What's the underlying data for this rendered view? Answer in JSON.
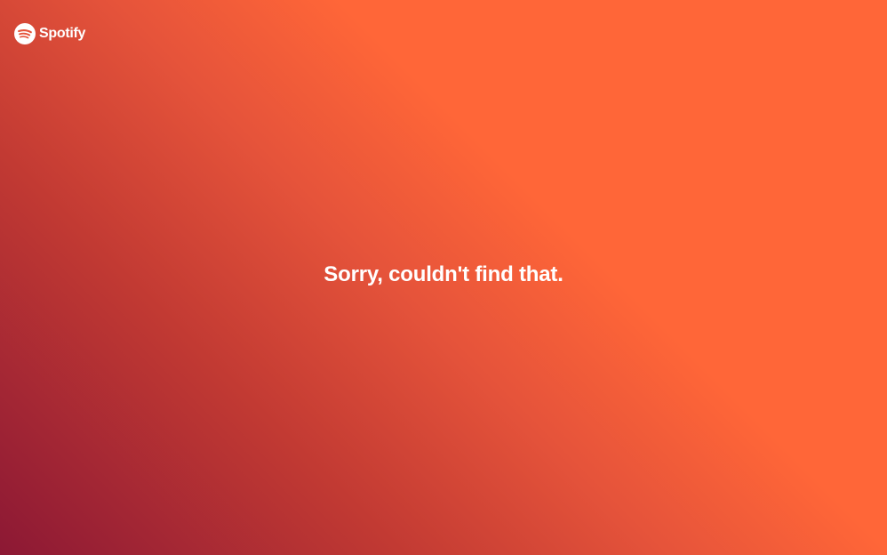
{
  "brand": {
    "name": "Spotify",
    "icon": "spotify-logo-icon"
  },
  "error": {
    "message": "Sorry, couldn't find that."
  },
  "colors": {
    "gradient_start": "#8c1834",
    "gradient_mid": "#e5533a",
    "gradient_end": "#ff6638",
    "text": "#ffffff"
  }
}
